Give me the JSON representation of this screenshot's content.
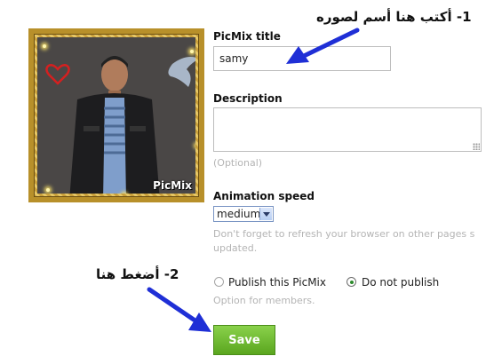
{
  "image": {
    "watermark": "PicMix"
  },
  "form": {
    "title_label": "PicMix title",
    "title_value": "samy",
    "description_label": "Description",
    "description_value": "",
    "description_hint": "(Optional)",
    "speed_label": "Animation speed",
    "speed_selected": "medium",
    "refresh_hint_line1": "Don't forget to refresh your browser on other pages s",
    "refresh_hint_line2": "updated.",
    "publish_option": "Publish this PicMix",
    "publish_selected": false,
    "nopublish_option": "Do not publish",
    "nopublish_selected": true,
    "members_hint": "Option for members.",
    "save_label": "Save"
  },
  "annotations": {
    "step1": "1- أكتب هنا أسم لصوره",
    "step2": "2- أضغط هنا"
  },
  "colors": {
    "arrow": "#1f2fd6",
    "save_button": "#6cb92f",
    "frame_gold": "#c9a03b"
  }
}
